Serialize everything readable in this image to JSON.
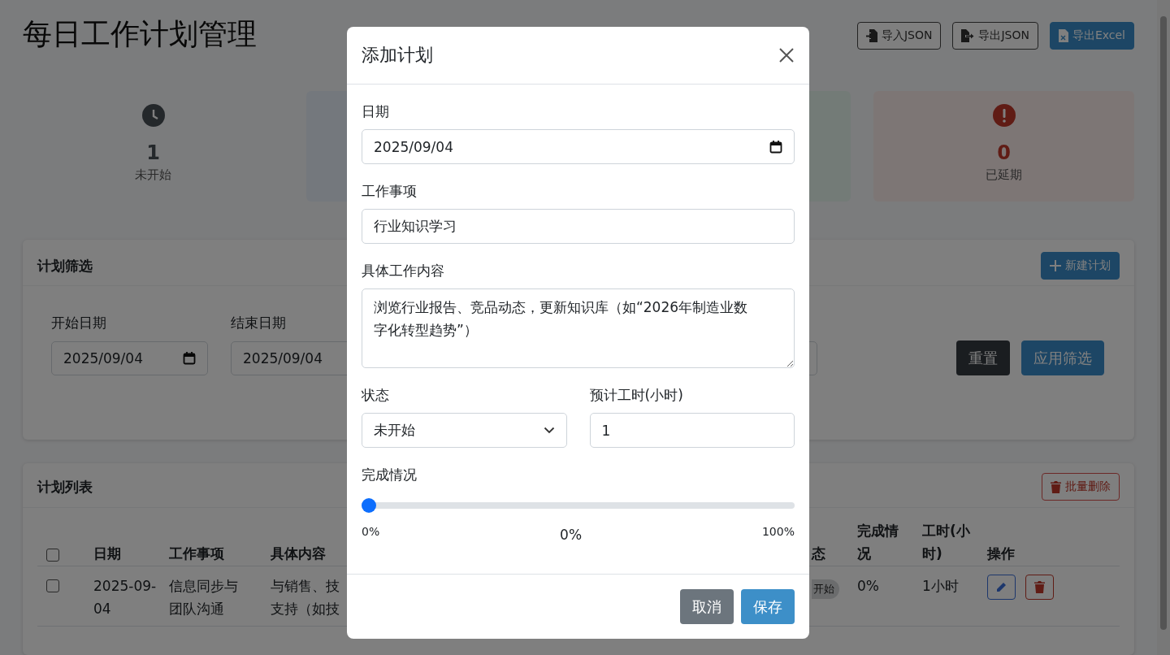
{
  "header": {
    "title": "每日工作计划管理",
    "actions": [
      {
        "label": "导入JSON",
        "kind": "outline"
      },
      {
        "label": "导出JSON",
        "kind": "outline"
      },
      {
        "label": "导出Excel",
        "kind": "primary"
      }
    ]
  },
  "stats": [
    {
      "kind": "pending",
      "value": "1",
      "label": "未开始"
    },
    {
      "kind": "active"
    },
    {
      "kind": "done"
    },
    {
      "kind": "delayed",
      "value": "0",
      "label": "已延期"
    }
  ],
  "filter": {
    "title": "计划筛选",
    "new_button": "新建计划",
    "fields": [
      {
        "kind": "date",
        "label": "开始日期",
        "value": "2025/09/04"
      },
      {
        "kind": "date_covered",
        "label": "结束日期",
        "value": "2025/09/04"
      },
      {
        "kind": "text"
      }
    ],
    "reset_button": "重置",
    "apply_button": "应用筛选"
  },
  "list": {
    "title": "计划列表",
    "bulk_delete_button": "批量删除",
    "select_all_checked": false,
    "columns": [
      "日期",
      "工作事项",
      "具体内容",
      "",
      "态",
      "完成情况",
      "工时(小时)",
      "操作"
    ],
    "rows": [
      {
        "checked": false,
        "date": "2025-09-04",
        "item": "信息同步与团队沟通",
        "content_lines": [
          "与销售、技",
          "支持（如技"
        ],
        "status": "开始",
        "progress": "0%",
        "hours": "1小时"
      }
    ]
  },
  "modal": {
    "title": "添加计划",
    "date": {
      "label": "日期",
      "value": "2025/09/04"
    },
    "item": {
      "label": "工作事项",
      "value": "行业知识学习"
    },
    "content": {
      "label": "具体工作内容",
      "value": "浏览行业报告、竞品动态，更新知识库（如“2026年制造业数字化转型趋势”）"
    },
    "status": {
      "label": "状态",
      "value": "未开始"
    },
    "hours": {
      "label": "预计工时(小时)",
      "value": "1"
    },
    "progress": {
      "label": "完成情况",
      "level": 0,
      "min_label": "0%",
      "reading": "0%",
      "max_label": "100%"
    },
    "cancel_button": "取消",
    "save_button": "保存"
  }
}
